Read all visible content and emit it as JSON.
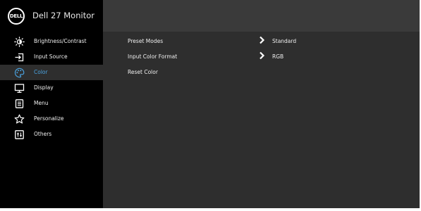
{
  "header": {
    "brand": "DELL",
    "title": "Dell 27 Monitor"
  },
  "sidebar": {
    "active_item": "color",
    "items": [
      {
        "label": "Brightness/Contrast",
        "icon": "brightness-icon"
      },
      {
        "label": "Input Source",
        "icon": "input-source-icon"
      },
      {
        "label": "Color",
        "icon": "color-palette-icon"
      },
      {
        "label": "Display",
        "icon": "display-icon"
      },
      {
        "label": "Menu",
        "icon": "menu-icon"
      },
      {
        "label": "Personalize",
        "icon": "star-icon"
      },
      {
        "label": "Others",
        "icon": "others-icon"
      }
    ]
  },
  "panel": {
    "rows": [
      {
        "label": "Preset Modes",
        "value": "Standard",
        "has_submenu": true
      },
      {
        "label": "Input Color Format",
        "value": "RGB",
        "has_submenu": true
      },
      {
        "label": "Reset Color",
        "value": "",
        "has_submenu": false
      }
    ]
  },
  "colors": {
    "accent": "#4aa3e0",
    "sidebar_bg": "#000000",
    "panel_bg": "#2e2e2e",
    "text": "#f0f0f0"
  }
}
